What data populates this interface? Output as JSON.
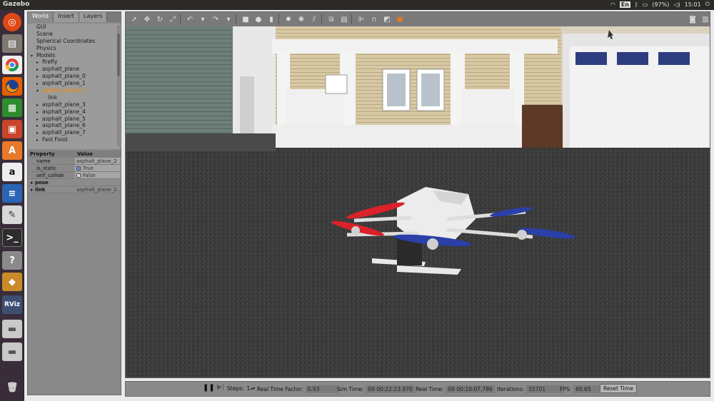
{
  "topbar": {
    "title": "Gazebo",
    "keyboard": "En",
    "battery": "(97%)",
    "time": "15:01"
  },
  "launcher": {
    "items": [
      "ubuntu-logo",
      "files",
      "chrome",
      "firefox",
      "spreadsheet",
      "presentation",
      "software-center",
      "amazon",
      "writer",
      "text-editor",
      "terminal",
      "help",
      "gazebo",
      "rviz",
      "drive",
      "drive",
      "trash"
    ],
    "rviz_label": "RViz",
    "amazon_label": "a"
  },
  "left_panel": {
    "tabs": [
      "World",
      "Insert",
      "Layers"
    ],
    "tree": [
      {
        "label": "GUI",
        "indent": 1,
        "arrow": ""
      },
      {
        "label": "Scene",
        "indent": 1,
        "arrow": ""
      },
      {
        "label": "Spherical Coordinates",
        "indent": 1,
        "arrow": ""
      },
      {
        "label": "Physics",
        "indent": 1,
        "arrow": ""
      },
      {
        "label": "Models",
        "indent": 1,
        "arrow": "▾"
      },
      {
        "label": "firefly",
        "indent": 2,
        "arrow": "▸"
      },
      {
        "label": "asphalt_plane",
        "indent": 2,
        "arrow": "▸"
      },
      {
        "label": "asphalt_plane_0",
        "indent": 2,
        "arrow": "▸"
      },
      {
        "label": "asphalt_plane_1",
        "indent": 2,
        "arrow": "▸"
      },
      {
        "label": "asphalt_plane_2",
        "indent": 2,
        "arrow": "▾"
      },
      {
        "label": "link",
        "indent": 3,
        "arrow": ""
      },
      {
        "label": "asphalt_plane_3",
        "indent": 2,
        "arrow": "▸"
      },
      {
        "label": "asphalt_plane_4",
        "indent": 2,
        "arrow": "▸"
      },
      {
        "label": "asphalt_plane_5",
        "indent": 2,
        "arrow": "▸"
      },
      {
        "label": "asphalt_plane_6",
        "indent": 2,
        "arrow": "▸"
      },
      {
        "label": "asphalt_plane_7",
        "indent": 2,
        "arrow": "▸"
      },
      {
        "label": "Fast Food",
        "indent": 2,
        "arrow": "▸"
      }
    ],
    "selected": "asphalt_plane_2",
    "props_header": {
      "property": "Property",
      "value": "Value"
    },
    "props": [
      {
        "key": "name",
        "value": "asphalt_plane_2",
        "type": "text"
      },
      {
        "key": "is_static",
        "value": "True",
        "type": "check"
      },
      {
        "key": "self_collide",
        "value": "False",
        "type": "check"
      },
      {
        "key": "pose",
        "value": "",
        "type": "group"
      },
      {
        "key": "link",
        "value": "asphalt_plane_2...",
        "type": "group"
      }
    ]
  },
  "bottom_bar": {
    "steps_label": "Steps:",
    "steps_value": "1",
    "rtf_label": "Real Time Factor:",
    "rtf_value": "0.93",
    "sim_time_label": "Sim Time:",
    "sim_time_value": "00 00:22:23.970",
    "real_time_label": "Real Time:",
    "real_time_value": "00 00:10:07.786",
    "iterations_label": "Iterations:",
    "iterations_value": "55701",
    "fps_label": "FPS:",
    "fps_value": "60.65",
    "reset_label": "Reset Time"
  },
  "colors": {
    "accent_selected": "#ff8a00",
    "launcher_bg": "#3a2d3a",
    "ubuntu_orange": "#dd4814",
    "rotor_red": "#d9222a",
    "rotor_blue": "#2a3fa8"
  }
}
